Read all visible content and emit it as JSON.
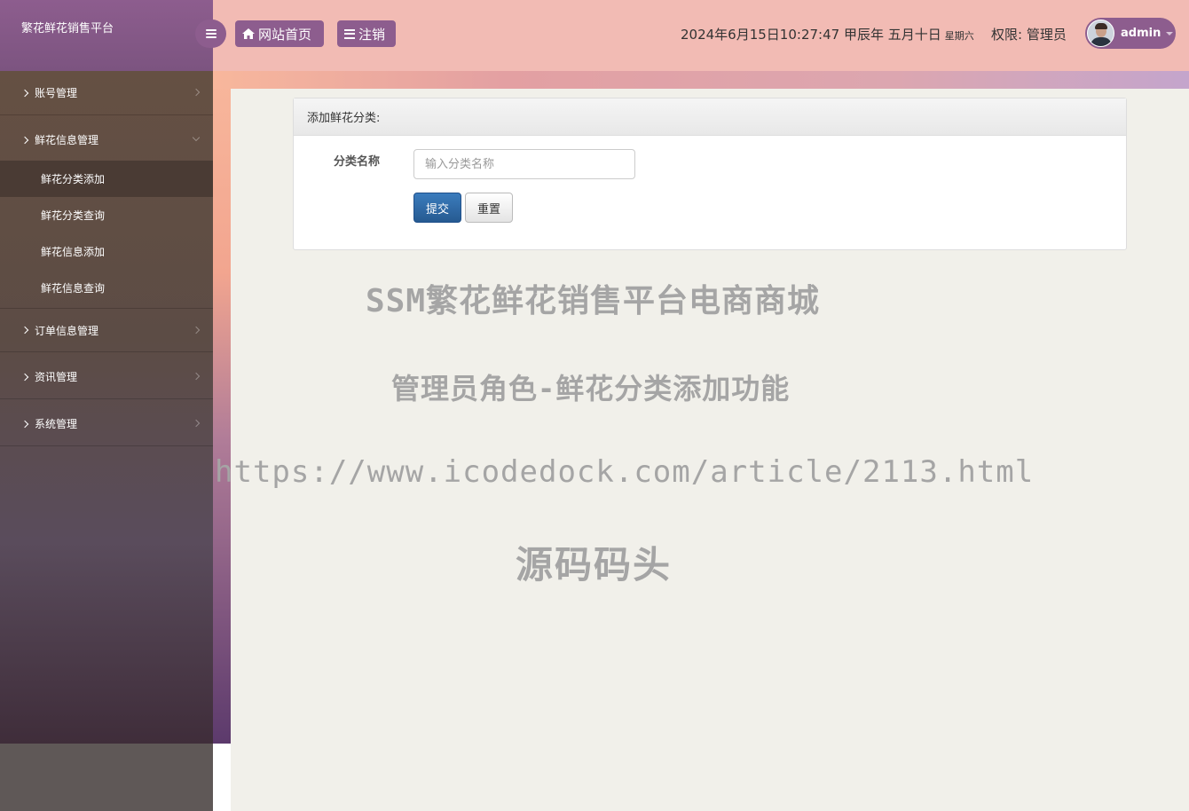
{
  "app": {
    "title": "繁花鲜花销售平台"
  },
  "topbar": {
    "home_label": "网站首页",
    "logout_label": "注销",
    "datetime": "2024年6月15日10:27:47 甲辰年 五月十日",
    "weekday": "星期六",
    "permission": "权限: 管理员",
    "username": "admin",
    "accent_color": "#8d5d8e",
    "bar_color": "#f2bbb4"
  },
  "sidebar": {
    "menu": [
      {
        "label": "账号管理"
      },
      {
        "label": "鲜花信息管理",
        "expanded": true,
        "children": [
          {
            "label": "鲜花分类添加",
            "active": true
          },
          {
            "label": "鲜花分类查询"
          },
          {
            "label": "鲜花信息添加"
          },
          {
            "label": "鲜花信息查询"
          }
        ]
      },
      {
        "label": "订单信息管理"
      },
      {
        "label": "资讯管理"
      },
      {
        "label": "系统管理"
      }
    ]
  },
  "form": {
    "heading": "添加鲜花分类:",
    "field_label": "分类名称",
    "field_placeholder": "输入分类名称",
    "field_value": "",
    "submit_label": "提交",
    "reset_label": "重置"
  },
  "watermark": {
    "line1": "SSM繁花鲜花销售平台电商商城",
    "line2": "管理员角色-鲜花分类添加功能",
    "line3": "https://www.icodedock.com/article/2113.html",
    "line4": "源码码头"
  }
}
